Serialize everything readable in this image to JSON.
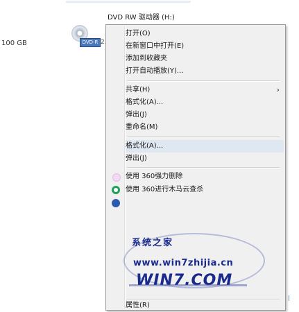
{
  "drive": {
    "label": "DVD RW 驱动器 (H:)",
    "capacity": "100 GB",
    "badge": "DVD-R",
    "side_number": "2.0"
  },
  "menu": {
    "items": [
      {
        "label": "打开(O)"
      },
      {
        "label": "在新窗口中打开(E)"
      },
      {
        "label": "添加到收藏夹"
      },
      {
        "label": "打开自动播放(Y)..."
      },
      {
        "label": "共享(H)",
        "submenu": true
      },
      {
        "label": "格式化(A)..."
      },
      {
        "label": "弹出(J)"
      },
      {
        "label": "使用 360强力删除"
      },
      {
        "label": "使用 360进行木马云查杀"
      },
      {
        "label": "重命名(M)"
      },
      {
        "label": "属性(R)"
      }
    ]
  },
  "watermark": {
    "line1": "系统之家",
    "url": "www.win7zhijia.cn",
    "big": "WIN7.COM"
  },
  "colors": {
    "menu_bg": "#f0f0f0",
    "highlight": "#dfe7f1",
    "watermark": "#1a2a8c"
  }
}
